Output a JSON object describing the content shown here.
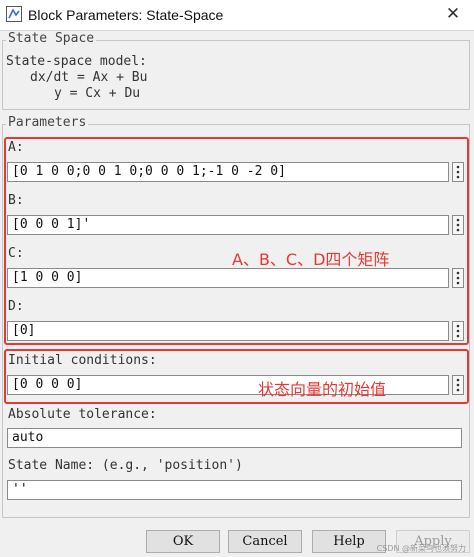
{
  "window": {
    "title": "Block Parameters: State-Space",
    "close_symbol": "✕"
  },
  "state_space": {
    "legend": "State Space",
    "description_line1": "State-space model:",
    "description_line2": "dx/dt = Ax + Bu",
    "description_line3": "y = Cx + Du"
  },
  "parameters": {
    "legend": "Parameters",
    "a_label": "A:",
    "a_value": "[0 1 0 0;0 0 1 0;0 0 0 1;-1 0 -2 0]",
    "b_label": "B:",
    "b_value": "[0 0 0 1]'",
    "c_label": "C:",
    "c_value": "[1 0 0 0]",
    "d_label": "D:",
    "d_value": "[0]",
    "initial_conditions_label": "Initial conditions:",
    "initial_conditions_value": "[0 0 0 0]",
    "absolute_tolerance_label": "Absolute tolerance:",
    "absolute_tolerance_value": "auto",
    "state_name_label": "State Name: (e.g., 'position')",
    "state_name_value": "''"
  },
  "annotations": {
    "matrices_note": "A、B、C、D四个矩阵",
    "initial_note": "状态向量的初始值",
    "color": "#e53935"
  },
  "buttons": {
    "ok": "OK",
    "cancel": "Cancel",
    "help": "Help",
    "apply": "Apply"
  },
  "watermark": "CSDN @新菜鸟也须努力"
}
